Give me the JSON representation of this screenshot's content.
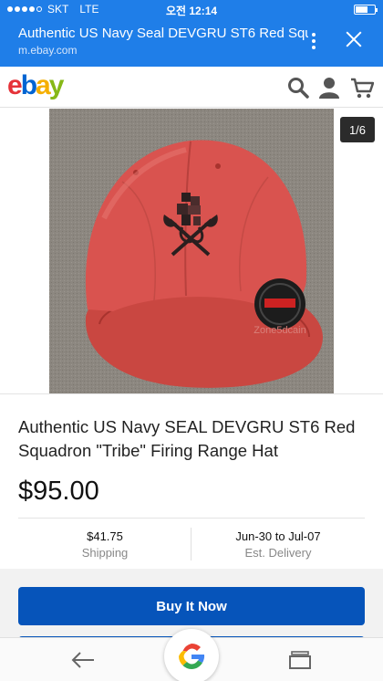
{
  "status": {
    "carrier": "SKT",
    "network": "LTE",
    "time": "오전 12:14"
  },
  "browser": {
    "page_title": "Authentic US Navy Seal DEVGRU ST6 Red Squa...",
    "url": "m.ebay.com"
  },
  "header": {
    "logo_letters": [
      "e",
      "b",
      "a",
      "y"
    ],
    "icons": [
      "search-icon",
      "user-icon",
      "cart-icon"
    ]
  },
  "gallery": {
    "counter": "1/6",
    "watermark": "Zone5dcain"
  },
  "product": {
    "title": "Authentic US Navy SEAL DEVGRU ST6 Red Squadron \"Tribe\" Firing Range Hat",
    "price": "$95.00"
  },
  "info": {
    "shipping_value": "$41.75",
    "shipping_label": "Shipping",
    "delivery_value": "Jun-30 to Jul-07",
    "delivery_label": "Est. Delivery"
  },
  "actions": {
    "buy_now": "Buy It Now"
  },
  "colors": {
    "browser_bar": "#1f7ee8",
    "buy_button": "#0654ba",
    "hat_red": "#d9534f"
  }
}
